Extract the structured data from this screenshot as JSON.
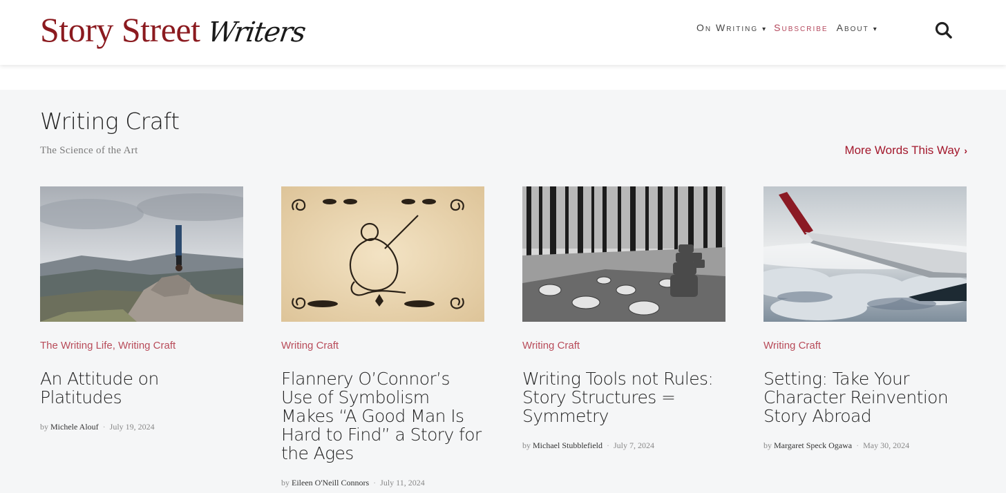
{
  "site": {
    "logo_main": "Story Street",
    "logo_script": "Writers"
  },
  "nav": {
    "items": [
      {
        "first": "O",
        "rest": "n ",
        "first2": "W",
        "rest2": "riting",
        "caret": true
      },
      {
        "label": "Subscribe",
        "accent": true
      },
      {
        "first": "A",
        "rest": "bout",
        "caret": true
      }
    ],
    "on_writing": "On Writing",
    "subscribe": "Subscribe",
    "about": "About",
    "caret": "▾",
    "search_icon": "search-icon"
  },
  "section": {
    "title": "Writing Craft",
    "subtitle": "The Science of the Art",
    "more_link": "More Words This Way",
    "more_chevron": "›"
  },
  "posts": [
    {
      "categories": [
        "The Writing Life",
        "Writing Craft"
      ],
      "title": "An Attitude on Platitudes",
      "by": "by",
      "author": "Michele Alouf",
      "date": "July 19, 2024",
      "image": "person doing headstand on mountain rock"
    },
    {
      "categories": [
        "Writing Craft"
      ],
      "title": "Flannery O’Connor’s Use of Symbolism Makes “A Good Man Is Hard to Find” a Story for the Ages",
      "by": "by",
      "author": "Eileen O'Neill Connors",
      "date": "July 11, 2024",
      "image": "vintage monkey illustration on parchment"
    },
    {
      "categories": [
        "Writing Craft"
      ],
      "title": "Writing Tools not Rules: Story Structures = Symmetry",
      "by": "by",
      "author": "Michael Stubblefield",
      "date": "July 7, 2024",
      "image": "black and white forest with stone cairns"
    },
    {
      "categories": [
        "Writing Craft"
      ],
      "title": "Setting: Take Your Character Reinvention Story Abroad",
      "by": "by",
      "author": "Margaret Speck Ogawa",
      "date": "May 30, 2024",
      "image": "airplane wing above clouds"
    }
  ],
  "colors": {
    "brand": "#8b1a1f",
    "accent": "#a3182c",
    "category": "#b84b59",
    "background": "#f5f6f7"
  }
}
